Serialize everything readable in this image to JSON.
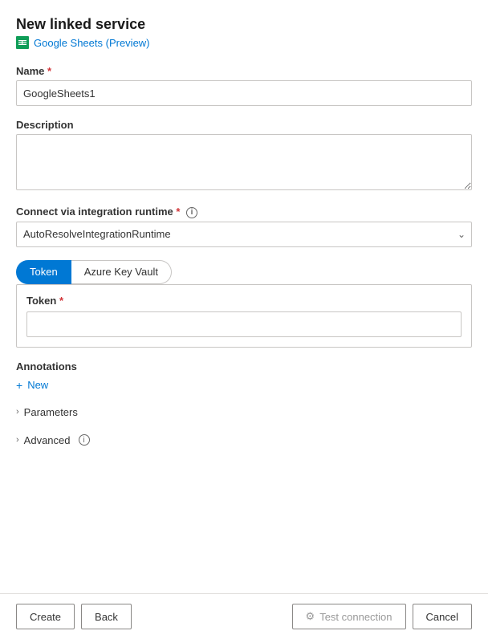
{
  "header": {
    "title": "New linked service",
    "subtitle": "Google Sheets (Preview)"
  },
  "form": {
    "name_label": "Name",
    "name_value": "GoogleSheets1",
    "description_label": "Description",
    "description_placeholder": "",
    "runtime_label": "Connect via integration runtime",
    "runtime_value": "AutoResolveIntegrationRuntime",
    "auth": {
      "token_label": "Token",
      "azure_label": "Azure Key Vault",
      "token_field_label": "Token"
    }
  },
  "annotations": {
    "label": "Annotations",
    "new_label": "New"
  },
  "parameters": {
    "label": "Parameters"
  },
  "advanced": {
    "label": "Advanced"
  },
  "footer": {
    "create_label": "Create",
    "back_label": "Back",
    "test_label": "Test connection",
    "cancel_label": "Cancel"
  },
  "icons": {
    "info": "i",
    "chevron_down": "∨",
    "chevron_right": "›",
    "plus": "+",
    "link": "🔗"
  }
}
